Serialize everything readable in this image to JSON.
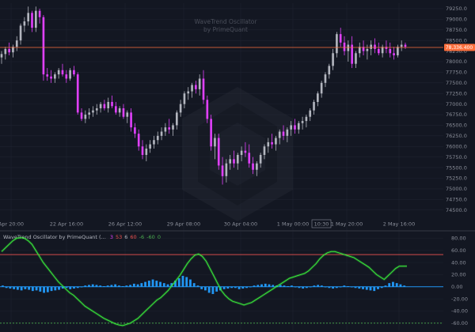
{
  "watermark": {
    "line1": "WaveTrend Oscillator",
    "line2": "by PrimeQuant"
  },
  "price_label": "78,336.400",
  "crosshair_label": "10:30",
  "indicator": {
    "title": "WaveTrend Oscillator by PrimeQuant (...",
    "values": [
      {
        "text": "3",
        "color": "#e040fb"
      },
      {
        "text": "53",
        "color": "#ef5350"
      },
      {
        "text": "6",
        "color": "#b2b5be"
      },
      {
        "text": "60",
        "color": "#ef5350"
      },
      {
        "text": "-6",
        "color": "#4caf50"
      },
      {
        "text": "-60",
        "color": "#4caf50"
      },
      {
        "text": "0",
        "color": "#4caf50"
      }
    ]
  },
  "colors": {
    "bg": "#131722",
    "grid": "#1f2330",
    "up": "#b2b5be",
    "down": "#e040fb",
    "price_line": "#ff6f3c",
    "wt1": "#39e83a",
    "hist": "#2196f3",
    "overbought": "#ef5350",
    "oversold": "#4caf50"
  },
  "chart_data": [
    {
      "type": "candlestick",
      "title": "",
      "x_ticks": [
        "Apr 20:00",
        "22 Apr 16:00",
        "26 Apr 12:00",
        "29 Apr 08:00",
        "30 Apr 04:00",
        "1 May 00:00",
        "1 May 20:00",
        "2 May 16:00"
      ],
      "y_ticks": [
        "79250.0",
        "79000.0",
        "78750.0",
        "78500.0",
        "78250.0",
        "78000.0",
        "77750.0",
        "77500.0",
        "77250.0",
        "77000.0",
        "76750.0",
        "76500.0",
        "76250.0",
        "76000.0",
        "75750.0",
        "75500.0",
        "75250.0",
        "75000.0",
        "74750.0",
        "74500.0"
      ],
      "ylim": [
        74420,
        79380
      ],
      "current_price": 78336.4,
      "ohlc": [
        [
          78100,
          78250,
          77950,
          78180
        ],
        [
          78180,
          78350,
          78050,
          78300
        ],
        [
          78300,
          78450,
          78150,
          78220
        ],
        [
          78220,
          78400,
          78100,
          78350
        ],
        [
          78350,
          78600,
          78250,
          78500
        ],
        [
          78500,
          78900,
          78400,
          78850
        ],
        [
          78850,
          79050,
          78700,
          78950
        ],
        [
          78950,
          79300,
          78850,
          79150
        ],
        [
          79150,
          79200,
          78700,
          78800
        ],
        [
          78800,
          79300,
          78700,
          79200
        ],
        [
          79200,
          79250,
          78900,
          79050
        ],
        [
          79050,
          79100,
          77550,
          77700
        ],
        [
          77700,
          77850,
          77550,
          77650
        ],
        [
          77650,
          77800,
          77500,
          77600
        ],
        [
          77600,
          77750,
          77500,
          77700
        ],
        [
          77700,
          77850,
          77600,
          77800
        ],
        [
          77800,
          77950,
          77650,
          77700
        ],
        [
          77700,
          77800,
          77500,
          77600
        ],
        [
          77600,
          77850,
          77550,
          77800
        ],
        [
          77800,
          77900,
          77650,
          77700
        ],
        [
          77700,
          77750,
          76750,
          76800
        ],
        [
          76800,
          76900,
          76600,
          76650
        ],
        [
          76650,
          76850,
          76550,
          76750
        ],
        [
          76750,
          76900,
          76650,
          76800
        ],
        [
          76800,
          76950,
          76700,
          76850
        ],
        [
          76850,
          77000,
          76750,
          76900
        ],
        [
          76900,
          77050,
          76800,
          77000
        ],
        [
          77000,
          77100,
          76850,
          76900
        ],
        [
          76900,
          77150,
          76800,
          77050
        ],
        [
          77050,
          77200,
          76900,
          76950
        ],
        [
          76950,
          77050,
          76750,
          76800
        ],
        [
          76800,
          76950,
          76700,
          76900
        ],
        [
          76900,
          77000,
          76650,
          76700
        ],
        [
          76700,
          76850,
          76550,
          76800
        ],
        [
          76800,
          76900,
          76350,
          76450
        ],
        [
          76450,
          76550,
          76200,
          76300
        ],
        [
          76300,
          76400,
          75900,
          76000
        ],
        [
          76000,
          76150,
          75700,
          75800
        ],
        [
          75800,
          76050,
          75650,
          75950
        ],
        [
          75950,
          76150,
          75850,
          76050
        ],
        [
          76050,
          76250,
          75950,
          76150
        ],
        [
          76150,
          76350,
          76050,
          76250
        ],
        [
          76250,
          76450,
          76150,
          76350
        ],
        [
          76350,
          76550,
          76250,
          76450
        ],
        [
          76450,
          76650,
          76300,
          76400
        ],
        [
          76400,
          76550,
          76250,
          76500
        ],
        [
          76500,
          76850,
          76400,
          76800
        ],
        [
          76800,
          77100,
          76700,
          77000
        ],
        [
          77000,
          77300,
          76900,
          77250
        ],
        [
          77250,
          77400,
          77100,
          77300
        ],
        [
          77300,
          77500,
          77150,
          77450
        ],
        [
          77450,
          77550,
          77250,
          77350
        ],
        [
          77350,
          77700,
          77200,
          77600
        ],
        [
          77600,
          77800,
          77000,
          77100
        ],
        [
          77100,
          77200,
          76550,
          76650
        ],
        [
          76650,
          76750,
          75900,
          76000
        ],
        [
          76000,
          76300,
          75700,
          76200
        ],
        [
          76200,
          76300,
          75450,
          75550
        ],
        [
          75550,
          75750,
          75100,
          75300
        ],
        [
          75300,
          75700,
          75150,
          75600
        ],
        [
          75600,
          75800,
          75450,
          75700
        ],
        [
          75700,
          75900,
          75500,
          75600
        ],
        [
          75600,
          75850,
          75450,
          75800
        ],
        [
          75800,
          76000,
          75650,
          75900
        ],
        [
          75900,
          76100,
          75750,
          75850
        ],
        [
          75850,
          76050,
          75500,
          75600
        ],
        [
          75600,
          75750,
          75350,
          75450
        ],
        [
          75450,
          75650,
          75300,
          75600
        ],
        [
          75600,
          75850,
          75500,
          75800
        ],
        [
          75800,
          76050,
          75700,
          76000
        ],
        [
          76000,
          76200,
          75850,
          76100
        ],
        [
          76100,
          76300,
          75950,
          76050
        ],
        [
          76050,
          76250,
          75900,
          76200
        ],
        [
          76200,
          76400,
          76050,
          76350
        ],
        [
          76350,
          76500,
          76150,
          76250
        ],
        [
          76250,
          76450,
          76100,
          76400
        ],
        [
          76400,
          76600,
          76250,
          76500
        ],
        [
          76500,
          76650,
          76300,
          76400
        ],
        [
          76400,
          76600,
          76300,
          76550
        ],
        [
          76550,
          76700,
          76400,
          76600
        ],
        [
          76600,
          76750,
          76450,
          76700
        ],
        [
          76700,
          76900,
          76600,
          76850
        ],
        [
          76850,
          77100,
          76750,
          77050
        ],
        [
          77050,
          77300,
          76950,
          77250
        ],
        [
          77250,
          77550,
          77150,
          77500
        ],
        [
          77500,
          77750,
          77400,
          77700
        ],
        [
          77700,
          77950,
          77600,
          77900
        ],
        [
          77900,
          78300,
          77800,
          78200
        ],
        [
          78200,
          78700,
          78100,
          78650
        ],
        [
          78650,
          78800,
          78350,
          78450
        ],
        [
          78450,
          78600,
          78150,
          78250
        ],
        [
          78250,
          78500,
          78000,
          78400
        ],
        [
          78400,
          78600,
          77850,
          77950
        ],
        [
          77950,
          78250,
          77850,
          78200
        ],
        [
          78200,
          78450,
          78100,
          78350
        ],
        [
          78350,
          78500,
          78150,
          78250
        ],
        [
          78250,
          78400,
          78050,
          78300
        ],
        [
          78300,
          78500,
          78150,
          78400
        ],
        [
          78400,
          78550,
          78200,
          78300
        ],
        [
          78300,
          78450,
          78150,
          78200
        ],
        [
          78200,
          78400,
          78100,
          78350
        ],
        [
          78350,
          78500,
          78200,
          78300
        ],
        [
          78300,
          78450,
          78100,
          78200
        ],
        [
          78200,
          78350,
          78050,
          78150
        ],
        [
          78150,
          78400,
          78100,
          78350
        ],
        [
          78350,
          78500,
          78250,
          78400
        ],
        [
          78400,
          78450,
          78300,
          78350
        ]
      ]
    },
    {
      "type": "line",
      "title": "WaveTrend Oscillator by PrimeQuant",
      "y_ticks": [
        "80.00",
        "60.00",
        "40.00",
        "20.00",
        "0.00",
        "-20.00",
        "-40.00",
        "-60.00"
      ],
      "ylim": [
        -72,
        87
      ],
      "levels": {
        "overbought": 53,
        "oversold": -60
      },
      "wt1": [
        58,
        64,
        70,
        76,
        80,
        81,
        80,
        76,
        70,
        60,
        50,
        40,
        32,
        24,
        16,
        8,
        2,
        -4,
        -10,
        -14,
        -20,
        -26,
        -32,
        -36,
        -40,
        -44,
        -48,
        -52,
        -55,
        -58,
        -61,
        -63,
        -64,
        -62,
        -60,
        -56,
        -52,
        -46,
        -40,
        -34,
        -28,
        -22,
        -18,
        -12,
        -6,
        2,
        10,
        18,
        28,
        38,
        46,
        52,
        54,
        50,
        42,
        30,
        18,
        6,
        -6,
        -14,
        -20,
        -24,
        -26,
        -28,
        -30,
        -28,
        -26,
        -22,
        -18,
        -14,
        -10,
        -6,
        -2,
        2,
        6,
        10,
        14,
        16,
        18,
        20,
        22,
        26,
        32,
        38,
        46,
        52,
        56,
        58,
        58,
        56,
        54,
        52,
        50,
        48,
        44,
        40,
        36,
        32,
        26,
        20,
        16,
        12,
        18,
        24,
        30,
        34,
        34,
        34
      ],
      "histogram": [
        2,
        -2,
        -3,
        -4,
        -5,
        -6,
        -4,
        -5,
        -7,
        -6,
        -8,
        -10,
        -9,
        -7,
        -6,
        -5,
        -3,
        -2,
        -4,
        -3,
        -2,
        -1,
        2,
        3,
        4,
        3,
        2,
        1,
        2,
        3,
        4,
        2,
        1,
        2,
        3,
        5,
        4,
        6,
        8,
        10,
        12,
        10,
        8,
        6,
        4,
        6,
        10,
        14,
        18,
        16,
        12,
        6,
        2,
        -4,
        -6,
        -10,
        -12,
        -8,
        -6,
        -4,
        -3,
        -2,
        -2,
        -4,
        -3,
        -2,
        -1,
        2,
        3,
        4,
        5,
        4,
        3,
        2,
        3,
        2,
        1,
        2,
        -1,
        -2,
        -3,
        -2,
        -1,
        2,
        3,
        2,
        -1,
        -2,
        -3,
        -2,
        -1,
        2,
        1,
        -1,
        -2,
        -3,
        -4,
        -5,
        -6,
        -7,
        -4,
        -2,
        2,
        6,
        8,
        6,
        4,
        2
      ]
    }
  ]
}
